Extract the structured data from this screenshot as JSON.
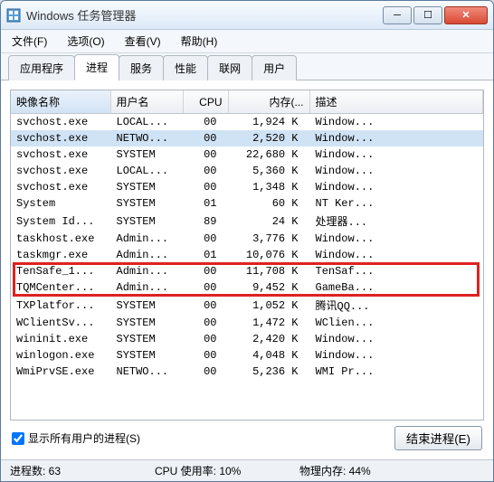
{
  "window": {
    "title": "Windows 任务管理器"
  },
  "menu": {
    "file": "文件(F)",
    "options": "选项(O)",
    "view": "查看(V)",
    "help": "帮助(H)"
  },
  "tabs": {
    "apps": "应用程序",
    "processes": "进程",
    "services": "服务",
    "performance": "性能",
    "network": "联网",
    "users": "用户"
  },
  "columns": {
    "image": "映像名称",
    "user": "用户名",
    "cpu": "CPU",
    "memory": "内存(...",
    "desc": "描述"
  },
  "rows": [
    {
      "img": "svchost.exe",
      "user": "LOCAL...",
      "cpu": "00",
      "mem": "1,924 K",
      "desc": "Window..."
    },
    {
      "img": "svchost.exe",
      "user": "NETWO...",
      "cpu": "00",
      "mem": "2,520 K",
      "desc": "Window...",
      "selected": true
    },
    {
      "img": "svchost.exe",
      "user": "SYSTEM",
      "cpu": "00",
      "mem": "22,680 K",
      "desc": "Window..."
    },
    {
      "img": "svchost.exe",
      "user": "LOCAL...",
      "cpu": "00",
      "mem": "5,360 K",
      "desc": "Window..."
    },
    {
      "img": "svchost.exe",
      "user": "SYSTEM",
      "cpu": "00",
      "mem": "1,348 K",
      "desc": "Window..."
    },
    {
      "img": "System",
      "user": "SYSTEM",
      "cpu": "01",
      "mem": "60 K",
      "desc": "NT Ker..."
    },
    {
      "img": "System Id...",
      "user": "SYSTEM",
      "cpu": "89",
      "mem": "24 K",
      "desc": "处理器..."
    },
    {
      "img": "taskhost.exe",
      "user": "Admin...",
      "cpu": "00",
      "mem": "3,776 K",
      "desc": "Window..."
    },
    {
      "img": "taskmgr.exe",
      "user": "Admin...",
      "cpu": "01",
      "mem": "10,076 K",
      "desc": "Window..."
    },
    {
      "img": "TenSafe_1...",
      "user": "Admin...",
      "cpu": "00",
      "mem": "11,708 K",
      "desc": "TenSaf..."
    },
    {
      "img": "TQMCenter...",
      "user": "Admin...",
      "cpu": "00",
      "mem": "9,452 K",
      "desc": "GameBa..."
    },
    {
      "img": "TXPlatfor...",
      "user": "SYSTEM",
      "cpu": "00",
      "mem": "1,052 K",
      "desc": "腾讯QQ..."
    },
    {
      "img": "WClientSv...",
      "user": "SYSTEM",
      "cpu": "00",
      "mem": "1,472 K",
      "desc": "WClien..."
    },
    {
      "img": "wininit.exe",
      "user": "SYSTEM",
      "cpu": "00",
      "mem": "2,420 K",
      "desc": "Window..."
    },
    {
      "img": "winlogon.exe",
      "user": "SYSTEM",
      "cpu": "00",
      "mem": "4,048 K",
      "desc": "Window..."
    },
    {
      "img": "WmiPrvSE.exe",
      "user": "NETWO...",
      "cpu": "00",
      "mem": "5,236 K",
      "desc": "WMI Pr..."
    }
  ],
  "show_all_users": "显示所有用户的进程(S)",
  "end_process": "结束进程(E)",
  "status": {
    "procs": "进程数: 63",
    "cpu": "CPU 使用率: 10%",
    "mem": "物理内存: 44%"
  },
  "highlight": {
    "startRow": 9,
    "endRow": 10
  }
}
